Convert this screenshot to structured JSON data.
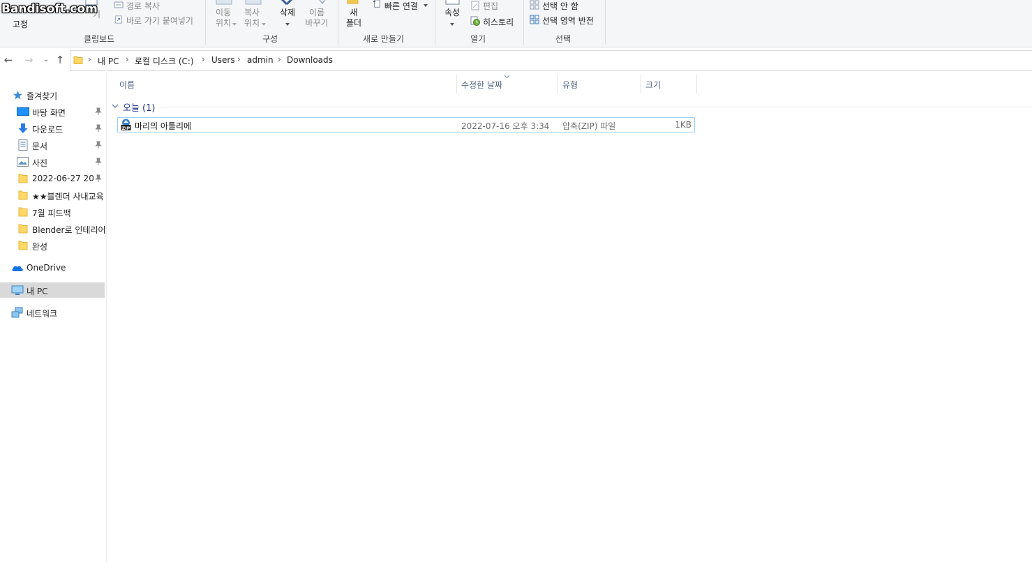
{
  "watermark": "Bandisoft.com",
  "ribbon": {
    "clipboard": {
      "pin_label": "고정",
      "copy_path": "경로 복사",
      "paste_shortcut": "바로 가기 붙여넣기",
      "paste_fragment": "기",
      "group_label": "클립보드"
    },
    "organize": {
      "move_to": [
        "이동",
        "위치"
      ],
      "copy_to": [
        "복사",
        "위치"
      ],
      "delete": "삭제",
      "rename": [
        "이름",
        "바꾸기"
      ],
      "group_label": "구성"
    },
    "new": {
      "new_folder": [
        "새",
        "폴더"
      ],
      "easy_access": "빠른 연결",
      "group_label": "새로 만들기"
    },
    "open": {
      "properties": "속성",
      "edit": "편집",
      "history": "히스토리",
      "group_label": "열기"
    },
    "select": {
      "select_none": "선택 안 함",
      "invert_selection": "선택 영역 반전",
      "group_label": "선택"
    }
  },
  "nav": {
    "breadcrumbs": [
      "내 PC",
      "로컬 디스크 (C:)",
      "Users",
      "admin",
      "Downloads"
    ]
  },
  "sidebar": {
    "quick_access": "즐겨찾기",
    "items": [
      {
        "label": "바탕 화면",
        "icon": "desktop-icon",
        "pinned": true
      },
      {
        "label": "다운로드",
        "icon": "download-icon",
        "pinned": true
      },
      {
        "label": "문서",
        "icon": "document-icon",
        "pinned": true
      },
      {
        "label": "사진",
        "icon": "pictures-icon",
        "pinned": true
      },
      {
        "label": "2022-06-27 20.",
        "icon": "folder-icon",
        "pinned": true
      },
      {
        "label": "★★블렌더 사내교육",
        "icon": "folder-icon",
        "pinned": false
      },
      {
        "label": "7월 피드백",
        "icon": "folder-icon",
        "pinned": false
      },
      {
        "label": "Blender로 인테리어",
        "icon": "folder-icon",
        "pinned": false
      },
      {
        "label": "완성",
        "icon": "folder-icon",
        "pinned": false
      }
    ],
    "onedrive": "OneDrive",
    "this_pc": "내 PC",
    "network": "네트워크"
  },
  "columns": {
    "name": "이름",
    "date": "수정한 날짜",
    "type": "유형",
    "size": "크기"
  },
  "group": {
    "label": "오늘 (1)"
  },
  "files": [
    {
      "name": "마리의 아틀리에",
      "date": "2022-07-16 오후 3:34",
      "type": "압축(ZIP) 파일",
      "size": "1KB"
    }
  ],
  "colors": {
    "ribbon_bg": "#f5f6f7",
    "selection_border": "#99d1ff",
    "sidebar_selected": "#d9d9d9",
    "header_text": "#4c607a",
    "group_text": "#1e3287",
    "folder_yellow": "#ffd866"
  }
}
